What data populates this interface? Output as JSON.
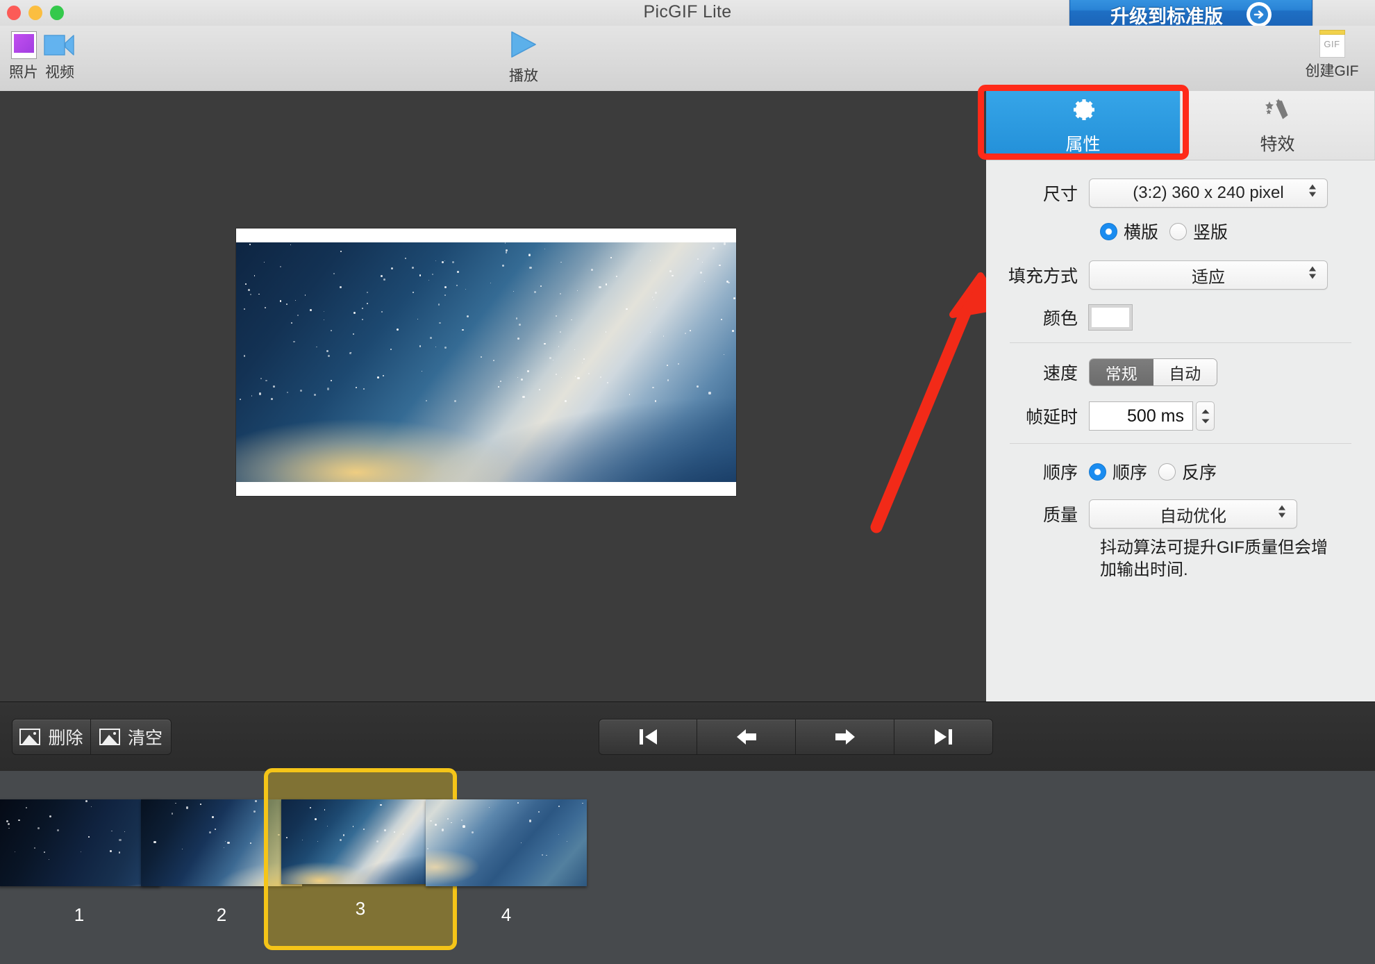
{
  "window": {
    "title": "PicGIF Lite",
    "upgrade_label": "升级到标准版"
  },
  "toolbar": {
    "photo_label": "照片",
    "video_label": "视频",
    "play_label": "播放",
    "gif_label": "创建GIF",
    "gif_icon_text": "GIF"
  },
  "panel": {
    "tabs": [
      {
        "label": "属性",
        "icon": "gear-icon",
        "active": true
      },
      {
        "label": "特效",
        "icon": "magic-wand-icon",
        "active": false
      }
    ],
    "size": {
      "label": "尺寸",
      "value": "(3:2) 360 x 240 pixel",
      "orientation": [
        {
          "label": "横版",
          "selected": true
        },
        {
          "label": "竖版",
          "selected": false
        }
      ]
    },
    "fill": {
      "label": "填充方式",
      "value": "适应"
    },
    "color": {
      "label": "颜色",
      "value": "#ffffff"
    },
    "speed": {
      "label": "速度",
      "options": [
        {
          "label": "常规",
          "selected": true
        },
        {
          "label": "自动",
          "selected": false
        }
      ]
    },
    "frame_delay": {
      "label": "帧延时",
      "value": "500 ms"
    },
    "order": {
      "label": "顺序",
      "options": [
        {
          "label": "顺序",
          "selected": true
        },
        {
          "label": "反序",
          "selected": false
        }
      ]
    },
    "quality": {
      "label": "质量",
      "value": "自动优化",
      "hint": "抖动算法可提升GIF质量但会增加输出时间."
    }
  },
  "bottom_toolbar": {
    "delete_label": "删除",
    "clear_label": "清空",
    "nav": [
      {
        "name": "first-frame-button",
        "icon": "skip-back-icon"
      },
      {
        "name": "previous-frame-button",
        "icon": "arrow-left-icon"
      },
      {
        "name": "next-frame-button",
        "icon": "arrow-right-icon"
      },
      {
        "name": "last-frame-button",
        "icon": "skip-forward-icon"
      }
    ]
  },
  "filmstrip": {
    "frames": [
      {
        "number": "1",
        "selected": false
      },
      {
        "number": "2",
        "selected": false
      },
      {
        "number": "3",
        "selected": true
      },
      {
        "number": "4",
        "selected": false
      }
    ]
  },
  "annotations": {
    "highlight_color": "#ff2a19",
    "selection_color": "#f5c518"
  }
}
